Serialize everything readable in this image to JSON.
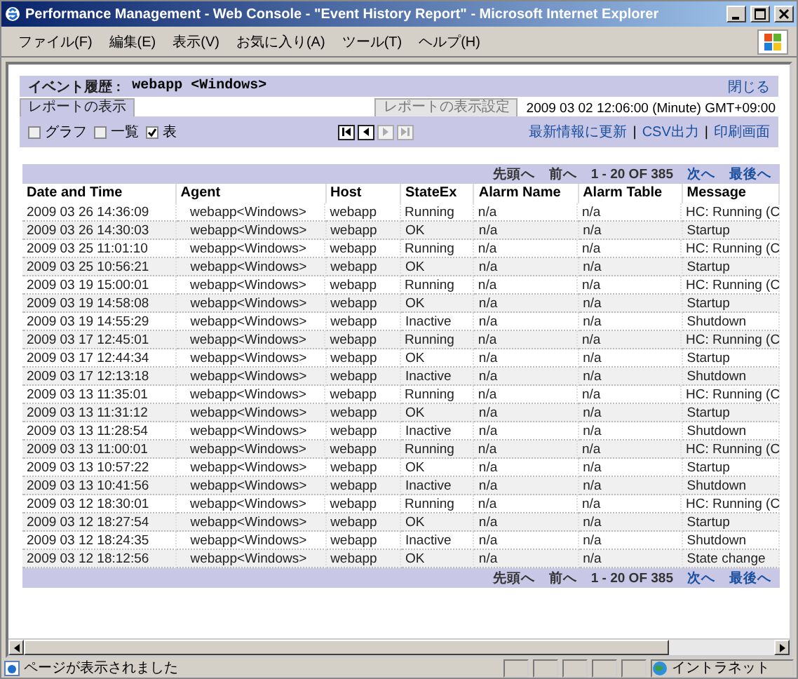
{
  "window": {
    "title": "Performance Management - Web Console - \"Event History Report\" - Microsoft Internet Explorer"
  },
  "menu": [
    "ファイル(F)",
    "編集(E)",
    "表示(V)",
    "お気に入り(A)",
    "ツール(T)",
    "ヘルプ(H)"
  ],
  "header": {
    "label": "イベント履歴 :",
    "agent": "webapp <Windows>",
    "close": "閉じる"
  },
  "tabs": [
    {
      "label": "レポートの表示",
      "selected": true
    },
    {
      "label": "レポートの表示設定",
      "selected": false
    }
  ],
  "report_time": "2009 03 02 12:06:00  (Minute)  GMT+09:00",
  "views": [
    {
      "label": "グラフ",
      "checked": false
    },
    {
      "label": "一覧",
      "checked": false
    },
    {
      "label": "表",
      "checked": true
    }
  ],
  "nav_buttons": [
    {
      "kind": "first",
      "disabled": false
    },
    {
      "kind": "prev",
      "disabled": false
    },
    {
      "kind": "next",
      "disabled": true
    },
    {
      "kind": "last",
      "disabled": true
    }
  ],
  "links": [
    "最新情報に更新",
    "CSV出力",
    "印刷画面"
  ],
  "link_separator": "|",
  "pagers": [
    {
      "first": "先頭へ",
      "prev": "前へ",
      "range": "1 - 20 OF 385",
      "next": "次へ",
      "last": "最後へ"
    },
    {
      "first": "先頭へ",
      "prev": "前へ",
      "range": "1 - 20 OF 385",
      "next": "次へ",
      "last": "最後へ"
    }
  ],
  "table": {
    "columns": [
      "Date and Time",
      "Agent",
      "Host",
      "StateEx",
      "Alarm Name",
      "Alarm Table",
      "Message"
    ],
    "rows": [
      [
        "2009 03 26 14:36:09",
        "webapp<Windows>",
        "webapp",
        "Running",
        "n/a",
        "n/a",
        "HC: Running (C"
      ],
      [
        "2009 03 26 14:30:03",
        "webapp<Windows>",
        "webapp",
        "OK",
        "n/a",
        "n/a",
        "Startup"
      ],
      [
        "2009 03 25 11:01:10",
        "webapp<Windows>",
        "webapp",
        "Running",
        "n/a",
        "n/a",
        "HC: Running (C"
      ],
      [
        "2009 03 25 10:56:21",
        "webapp<Windows>",
        "webapp",
        "OK",
        "n/a",
        "n/a",
        "Startup"
      ],
      [
        "2009 03 19 15:00:01",
        "webapp<Windows>",
        "webapp",
        "Running",
        "n/a",
        "n/a",
        "HC: Running (C"
      ],
      [
        "2009 03 19 14:58:08",
        "webapp<Windows>",
        "webapp",
        "OK",
        "n/a",
        "n/a",
        "Startup"
      ],
      [
        "2009 03 19 14:55:29",
        "webapp<Windows>",
        "webapp",
        "Inactive",
        "n/a",
        "n/a",
        "Shutdown"
      ],
      [
        "2009 03 17 12:45:01",
        "webapp<Windows>",
        "webapp",
        "Running",
        "n/a",
        "n/a",
        "HC: Running (C"
      ],
      [
        "2009 03 17 12:44:34",
        "webapp<Windows>",
        "webapp",
        "OK",
        "n/a",
        "n/a",
        "Startup"
      ],
      [
        "2009 03 17 12:13:18",
        "webapp<Windows>",
        "webapp",
        "Inactive",
        "n/a",
        "n/a",
        "Shutdown"
      ],
      [
        "2009 03 13 11:35:01",
        "webapp<Windows>",
        "webapp",
        "Running",
        "n/a",
        "n/a",
        "HC: Running (C"
      ],
      [
        "2009 03 13 11:31:12",
        "webapp<Windows>",
        "webapp",
        "OK",
        "n/a",
        "n/a",
        "Startup"
      ],
      [
        "2009 03 13 11:28:54",
        "webapp<Windows>",
        "webapp",
        "Inactive",
        "n/a",
        "n/a",
        "Shutdown"
      ],
      [
        "2009 03 13 11:00:01",
        "webapp<Windows>",
        "webapp",
        "Running",
        "n/a",
        "n/a",
        "HC: Running (C"
      ],
      [
        "2009 03 13 10:57:22",
        "webapp<Windows>",
        "webapp",
        "OK",
        "n/a",
        "n/a",
        "Startup"
      ],
      [
        "2009 03 13 10:41:56",
        "webapp<Windows>",
        "webapp",
        "Inactive",
        "n/a",
        "n/a",
        "Shutdown"
      ],
      [
        "2009 03 12 18:30:01",
        "webapp<Windows>",
        "webapp",
        "Running",
        "n/a",
        "n/a",
        "HC: Running (C"
      ],
      [
        "2009 03 12 18:27:54",
        "webapp<Windows>",
        "webapp",
        "OK",
        "n/a",
        "n/a",
        "Startup"
      ],
      [
        "2009 03 12 18:24:35",
        "webapp<Windows>",
        "webapp",
        "Inactive",
        "n/a",
        "n/a",
        "Shutdown"
      ],
      [
        "2009 03 12 18:12:56",
        "webapp<Windows>",
        "webapp",
        "OK",
        "n/a",
        "n/a",
        "State change"
      ]
    ]
  },
  "status_bar": {
    "text": "ページが表示されました",
    "zone": "イントラネット"
  }
}
